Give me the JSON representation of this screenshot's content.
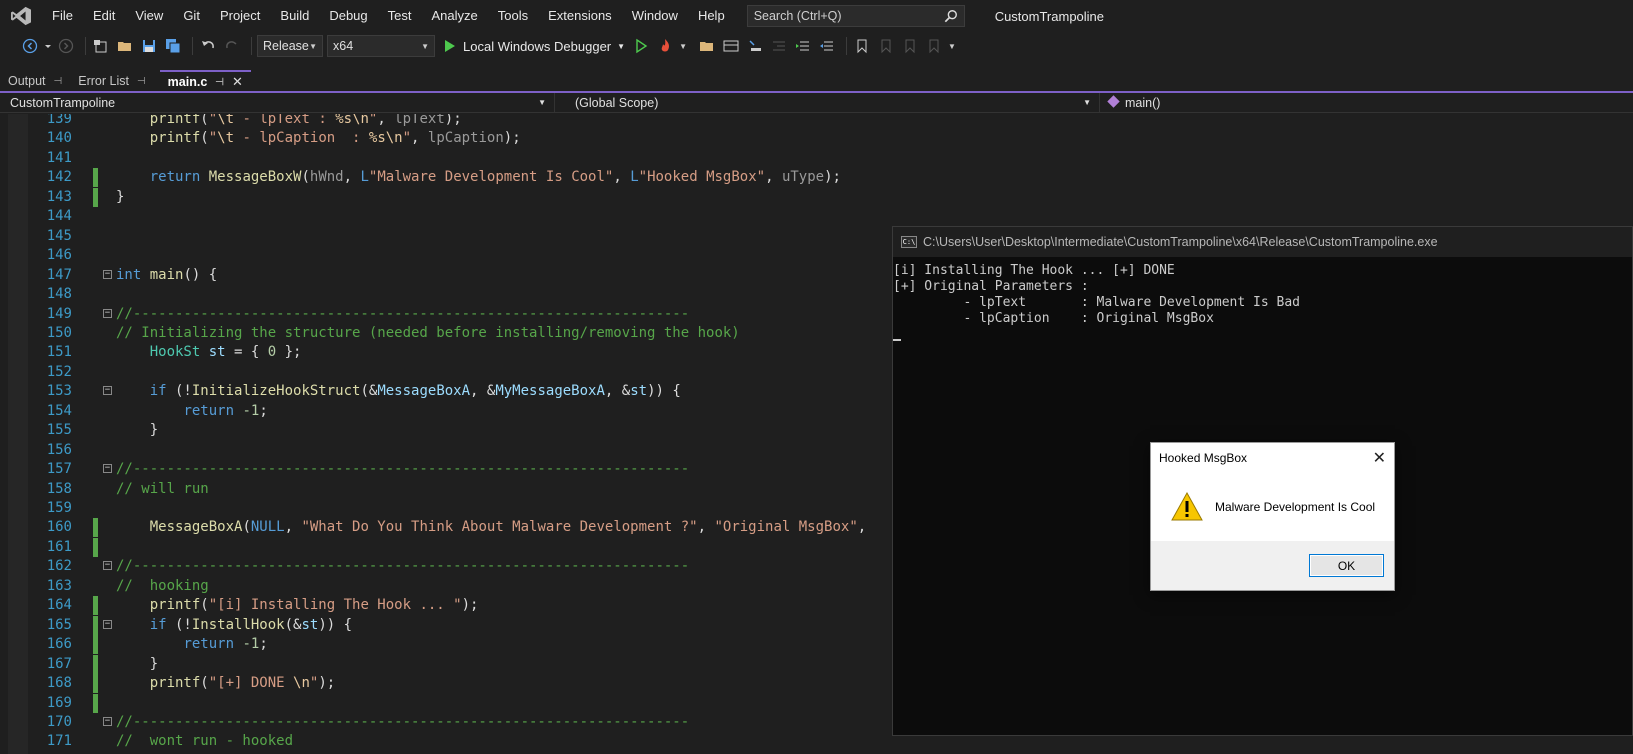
{
  "menu": {
    "items": [
      "File",
      "Edit",
      "View",
      "Git",
      "Project",
      "Build",
      "Debug",
      "Test",
      "Analyze",
      "Tools",
      "Extensions",
      "Window",
      "Help"
    ],
    "search_placeholder": "Search (Ctrl+Q)",
    "solution_name": "CustomTrampoline"
  },
  "toolbar": {
    "configuration": "Release",
    "platform": "x64",
    "debugger": "Local Windows Debugger"
  },
  "tabs": [
    {
      "label": "Output",
      "active": false
    },
    {
      "label": "Error List",
      "active": false
    },
    {
      "label": "main.c",
      "active": true
    }
  ],
  "navbar": {
    "project": "CustomTrampoline",
    "scope": "(Global Scope)",
    "member": "main()"
  },
  "editor": {
    "lines": [
      {
        "num": "139",
        "text": "    printf(\"\\t - lpText : %s\\n\", lpText);"
      },
      {
        "num": "140",
        "text": "    printf(\"\\t - lpCaption  : %s\\n\", lpCaption);"
      },
      {
        "num": "141",
        "text": ""
      },
      {
        "num": "142",
        "text": "    return MessageBoxW(hWnd, L\"Malware Development Is Cool\", L\"Hooked MsgBox\", uType);"
      },
      {
        "num": "143",
        "text": "}"
      },
      {
        "num": "144",
        "text": ""
      },
      {
        "num": "145",
        "text": ""
      },
      {
        "num": "146",
        "text": ""
      },
      {
        "num": "147",
        "text": "int main() {"
      },
      {
        "num": "148",
        "text": ""
      },
      {
        "num": "149",
        "text": "//------------------------------------------------------------------"
      },
      {
        "num": "150",
        "text": "// Initializing the structure (needed before installing/removing the hook)"
      },
      {
        "num": "151",
        "text": "    HookSt st = { 0 };"
      },
      {
        "num": "152",
        "text": ""
      },
      {
        "num": "153",
        "text": "    if (!InitializeHookStruct(&MessageBoxA, &MyMessageBoxA, &st)) {"
      },
      {
        "num": "154",
        "text": "        return -1;"
      },
      {
        "num": "155",
        "text": "    }"
      },
      {
        "num": "156",
        "text": ""
      },
      {
        "num": "157",
        "text": "//------------------------------------------------------------------"
      },
      {
        "num": "158",
        "text": "// will run"
      },
      {
        "num": "159",
        "text": ""
      },
      {
        "num": "160",
        "text": "    MessageBoxA(NULL, \"What Do You Think About Malware Development ?\", \"Original MsgBox\","
      },
      {
        "num": "161",
        "text": ""
      },
      {
        "num": "162",
        "text": "//------------------------------------------------------------------"
      },
      {
        "num": "163",
        "text": "//  hooking"
      },
      {
        "num": "164",
        "text": "    printf(\"[i] Installing The Hook ... \");"
      },
      {
        "num": "165",
        "text": "    if (!InstallHook(&st)) {"
      },
      {
        "num": "166",
        "text": "        return -1;"
      },
      {
        "num": "167",
        "text": "    }"
      },
      {
        "num": "168",
        "text": "    printf(\"[+] DONE \\n\");"
      },
      {
        "num": "169",
        "text": ""
      },
      {
        "num": "170",
        "text": "//------------------------------------------------------------------"
      },
      {
        "num": "171",
        "text": "//  wont run - hooked"
      }
    ]
  },
  "console": {
    "title": "C:\\Users\\User\\Desktop\\Intermediate\\CustomTrampoline\\x64\\Release\\CustomTrampoline.exe",
    "icon_label": "C:\\",
    "lines": [
      "[i] Installing The Hook ... [+] DONE",
      "[+] Original Parameters :",
      "         - lpText       : Malware Development Is Bad",
      "         - lpCaption    : Original MsgBox"
    ]
  },
  "dialog": {
    "title": "Hooked MsgBox",
    "message": "Malware Development Is Cool",
    "ok_label": "OK"
  }
}
